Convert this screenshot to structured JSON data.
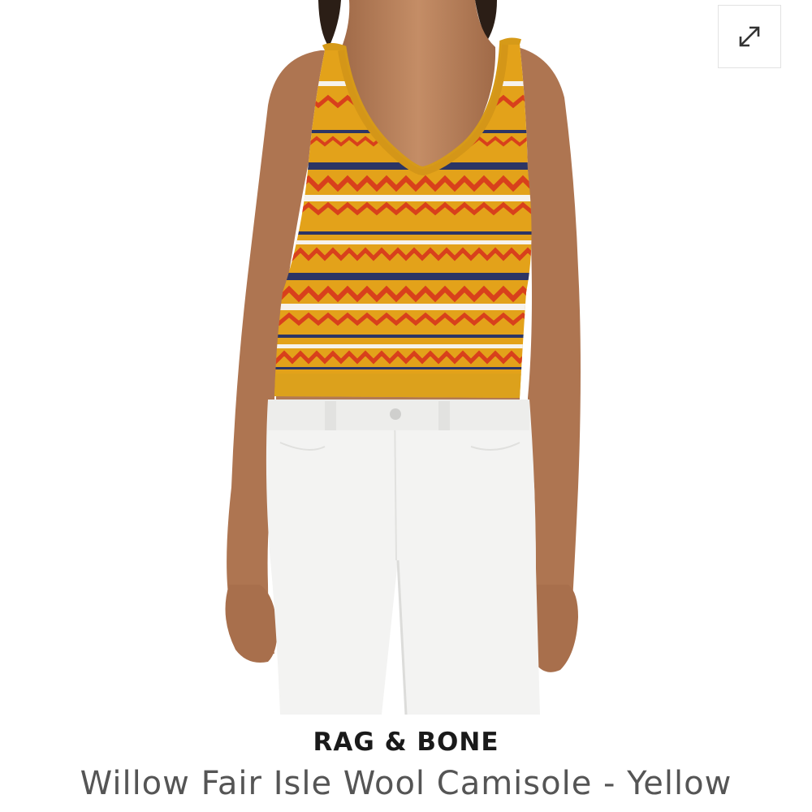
{
  "product": {
    "brand": "RAG & BONE",
    "title": "Willow Fair Isle Wool Camisole - Yellow"
  },
  "image": {
    "alt": "Model wearing yellow fair isle knit camisole with white jeans",
    "expand_icon": "expand-diagonal-arrows-icon"
  },
  "colors": {
    "camisole_yellow": "#E3A21A",
    "stripe_red": "#D8401C",
    "stripe_navy": "#2C3565",
    "stripe_white": "#F6F2EC",
    "jeans_white": "#F4F4F3",
    "skin": "#B27A55",
    "title_gray": "#555555",
    "brand_black": "#1A1A1A"
  }
}
